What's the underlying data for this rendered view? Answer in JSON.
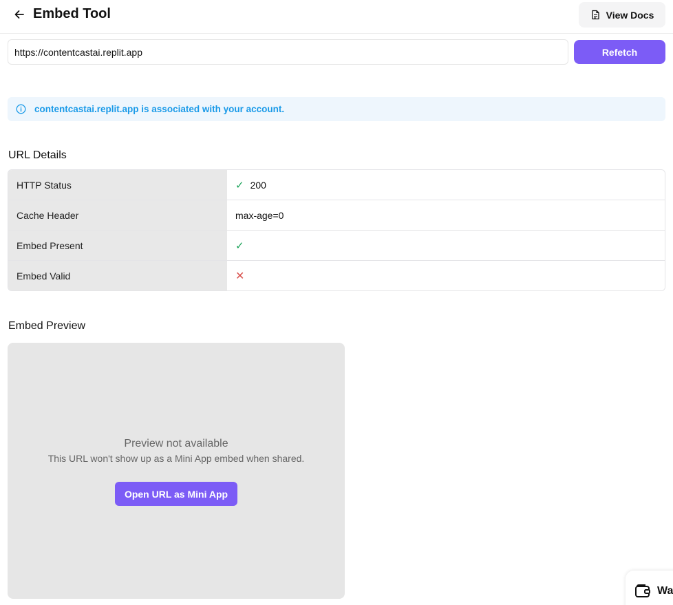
{
  "header": {
    "title": "Embed Tool",
    "view_docs_label": "View Docs",
    "back_icon": "arrow-left-icon",
    "docs_icon": "document-icon"
  },
  "url_bar": {
    "value": "https://contentcastai.replit.app",
    "refetch_label": "Refetch"
  },
  "info_banner": {
    "icon": "info-icon",
    "text": "contentcastai.replit.app is associated with your account."
  },
  "url_details": {
    "title": "URL Details",
    "rows": [
      {
        "label": "HTTP Status",
        "status": "success",
        "value": "200"
      },
      {
        "label": "Cache Header",
        "value": "max-age=0"
      },
      {
        "label": "Embed Present",
        "status": "success"
      },
      {
        "label": "Embed Valid",
        "status": "error"
      }
    ]
  },
  "embed_preview": {
    "title": "Embed Preview",
    "heading": "Preview not available",
    "message": "This URL won't show up as a Mini App embed when shared.",
    "button_label": "Open URL as Mini App"
  },
  "wallet": {
    "label": "Wa",
    "icon": "wallet-icon"
  },
  "colors": {
    "accent": "#7c5cf6",
    "info": "#1a9ae8",
    "success": "#1ba35a",
    "error": "#d9534f"
  }
}
